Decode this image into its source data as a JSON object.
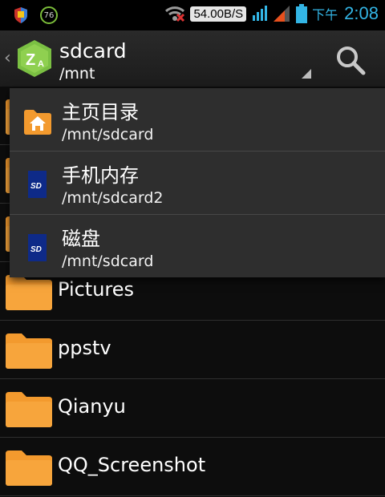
{
  "status_bar": {
    "battery_badge": "76",
    "net_speed": "54.00B/S",
    "ampm": "下午",
    "time": "2:08"
  },
  "action_bar": {
    "title": "sdcard",
    "subtitle": "/mnt",
    "icons": [
      "back-chevron-icon",
      "zarchiver-app-icon",
      "search-icon"
    ]
  },
  "dropdown": {
    "items": [
      {
        "name": "主页目录",
        "path": "/mnt/sdcard",
        "icon": "home-icon"
      },
      {
        "name": "手机内存",
        "path": "/mnt/sdcard2",
        "icon": "sd-card-icon"
      },
      {
        "name": "磁盘",
        "path": "/mnt/sdcard",
        "icon": "sd-card-icon"
      }
    ]
  },
  "files": [
    {
      "name": ""
    },
    {
      "name": ""
    },
    {
      "name": ""
    },
    {
      "name": "Pictures"
    },
    {
      "name": "ppstv"
    },
    {
      "name": "Qianyu"
    },
    {
      "name": "QQ_Screenshot"
    }
  ],
  "colors": {
    "accent_blue": "#33b5e5",
    "folder_orange": "#f39a2e",
    "app_green": "#7bc043"
  }
}
